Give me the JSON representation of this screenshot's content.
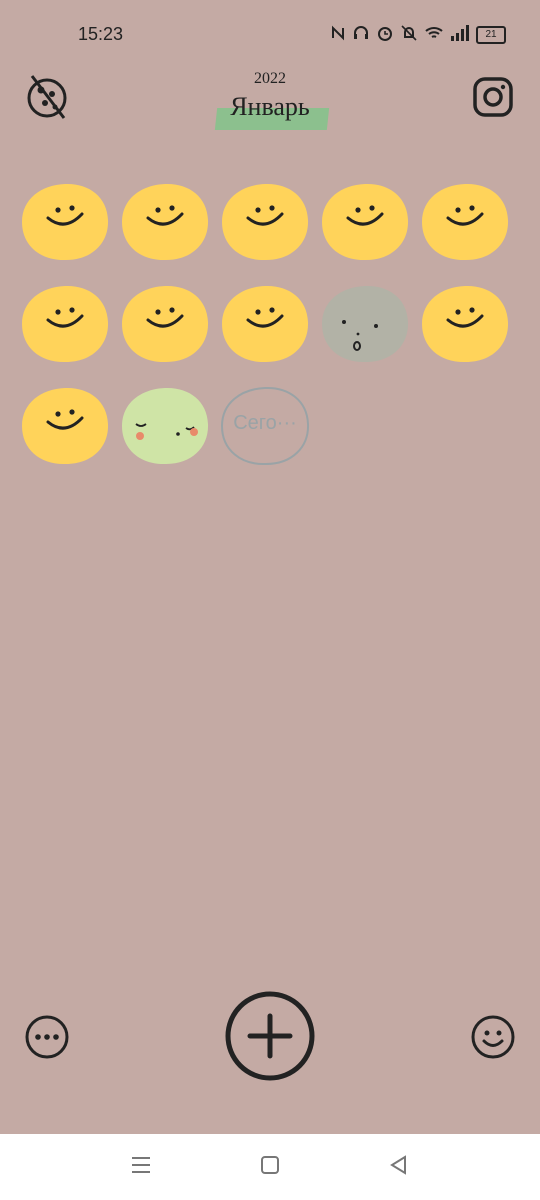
{
  "status": {
    "time": "15:23",
    "battery": "21"
  },
  "header": {
    "year": "2022",
    "month": "Январь"
  },
  "days": [
    {
      "mood": "happy"
    },
    {
      "mood": "happy"
    },
    {
      "mood": "happy"
    },
    {
      "mood": "happy"
    },
    {
      "mood": "happy"
    },
    {
      "mood": "happy"
    },
    {
      "mood": "happy"
    },
    {
      "mood": "happy"
    },
    {
      "mood": "surprised"
    },
    {
      "mood": "happy"
    },
    {
      "mood": "happy"
    },
    {
      "mood": "calm"
    },
    {
      "mood": "empty",
      "label": "Сего···"
    }
  ],
  "colors": {
    "background": "#c4aaa4",
    "happy": "#ffd35a",
    "surprised": "#b2b2a6",
    "calm": "#cfe4a6",
    "empty_outline": "#9aa3a6",
    "month_highlight": "#8cc08e"
  },
  "icons": {
    "logo": "planet-icon",
    "instagram": "instagram-icon",
    "more": "more-icon",
    "add": "add-icon",
    "mood": "smiley-icon"
  }
}
